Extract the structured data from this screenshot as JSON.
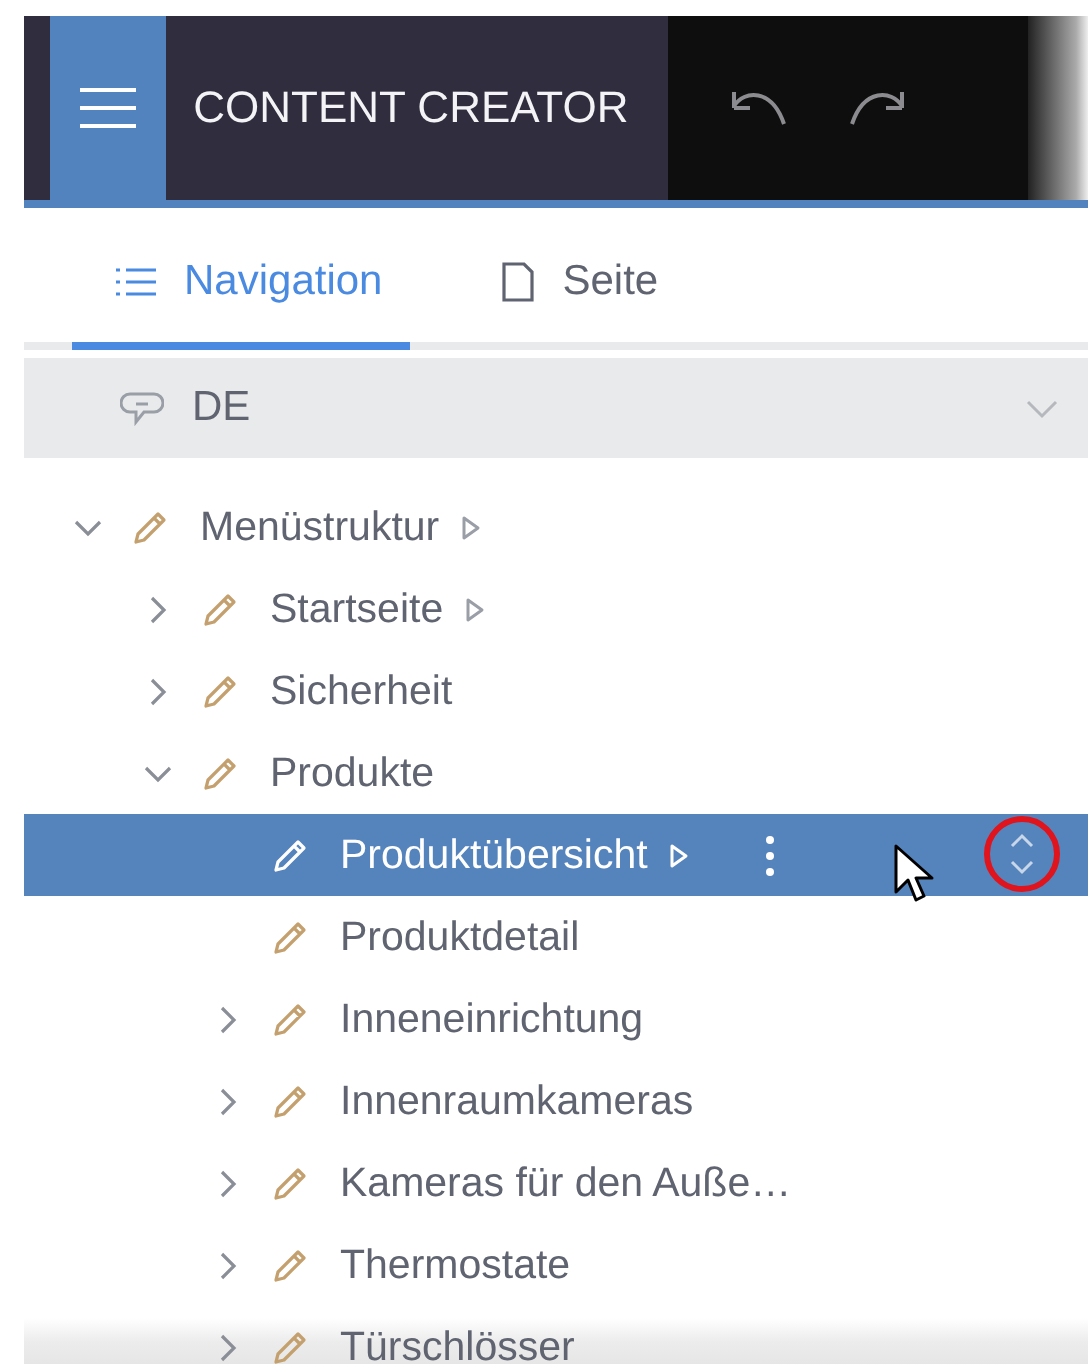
{
  "header": {
    "title": "CONTENT CREATOR"
  },
  "tabs": [
    {
      "label": "Navigation",
      "kind": "list",
      "selected": true
    },
    {
      "label": "Seite",
      "kind": "page",
      "selected": false
    }
  ],
  "language": {
    "label": "DE"
  },
  "tree": [
    {
      "label": "Menüstruktur",
      "kind": "folder",
      "expanded": true,
      "preview": true,
      "selected": false,
      "children": [
        {
          "label": "Startseite",
          "kind": "folder",
          "expanded": false,
          "preview": true,
          "selected": false
        },
        {
          "label": "Sicherheit",
          "kind": "folder",
          "expanded": false,
          "preview": false,
          "selected": false
        },
        {
          "label": "Produkte",
          "kind": "folder",
          "expanded": true,
          "preview": false,
          "selected": false,
          "children": [
            {
              "label": "Produktübersicht",
              "kind": "leaf",
              "preview": true,
              "selected": true
            },
            {
              "label": "Produktdetail",
              "kind": "leaf",
              "preview": false,
              "selected": false
            },
            {
              "label": "Inneneinrichtung",
              "kind": "folder",
              "expanded": false,
              "preview": false,
              "selected": false
            },
            {
              "label": "Innenraumkameras",
              "kind": "folder",
              "expanded": false,
              "preview": false,
              "selected": false
            },
            {
              "label": "Kameras für den Auße…",
              "kind": "folder",
              "expanded": false,
              "preview": false,
              "selected": false
            },
            {
              "label": "Thermostate",
              "kind": "folder",
              "expanded": false,
              "preview": false,
              "selected": false
            },
            {
              "label": "Türschlösser",
              "kind": "folder",
              "expanded": false,
              "preview": false,
              "selected": false
            }
          ]
        }
      ]
    }
  ]
}
